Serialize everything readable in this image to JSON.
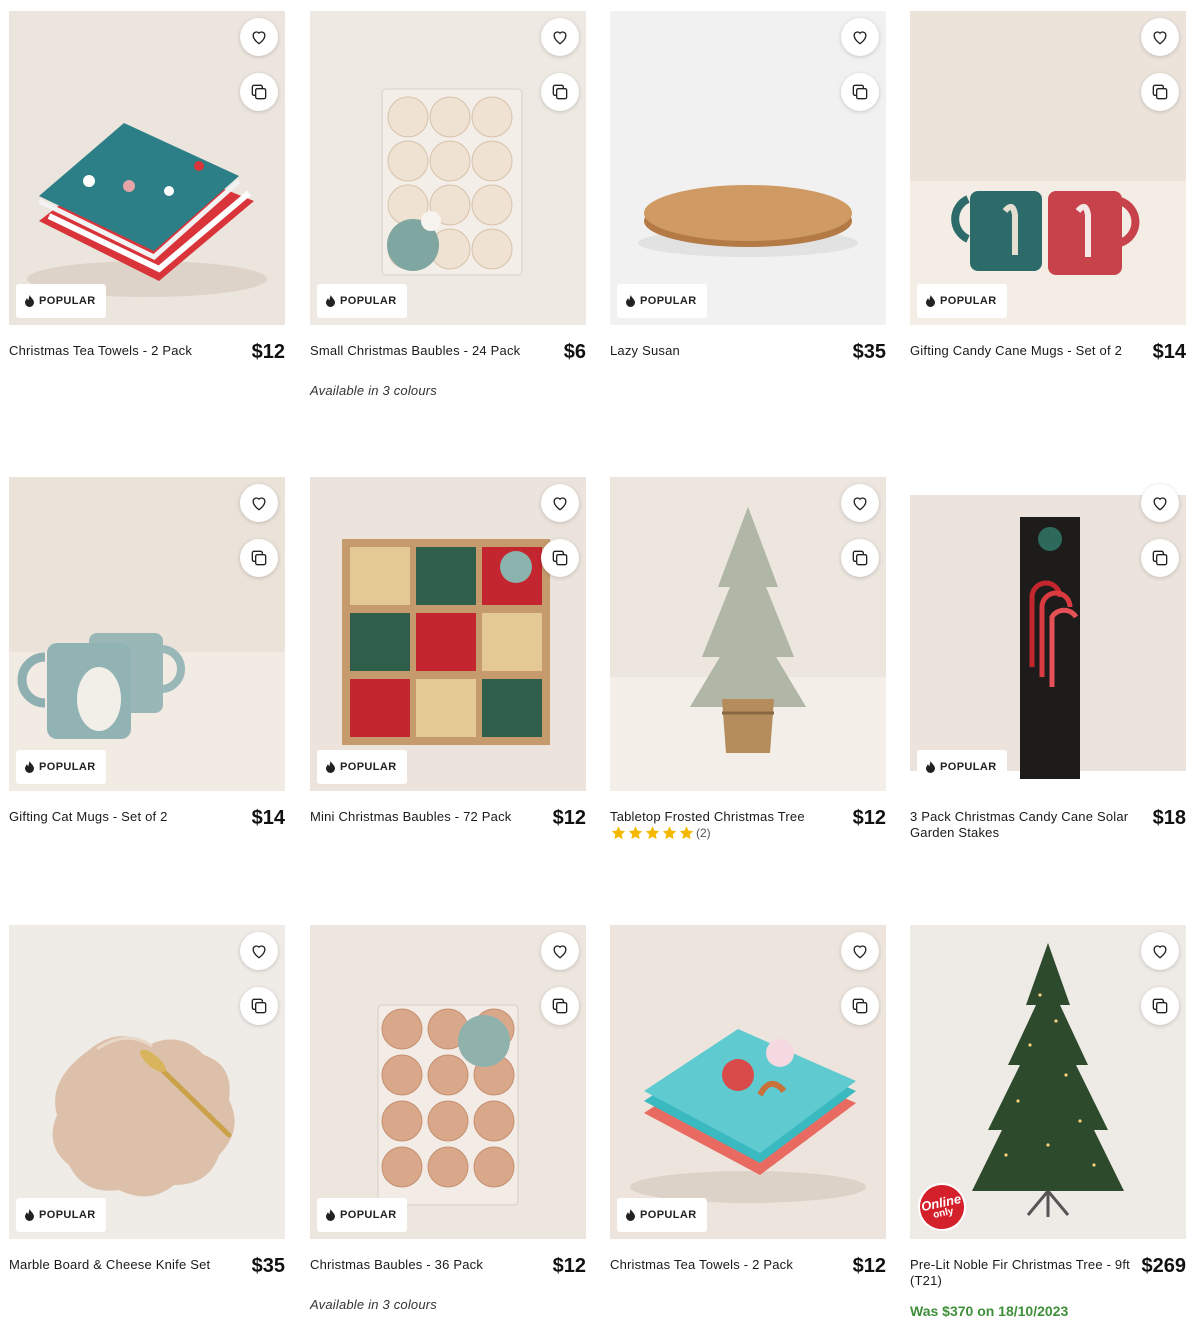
{
  "badge_label": "POPULAR",
  "online_only": {
    "line1": "Online",
    "line2": "only"
  },
  "products": [
    {
      "name": "Christmas Tea Towels - 2 Pack",
      "price": "$12",
      "badge": true,
      "icon": "tea-towels-photo"
    },
    {
      "name": "Small Christmas Baubles - 24 Pack",
      "price": "$6",
      "badge": true,
      "sub": "Available in 3 colours",
      "icon": "baubles-box-photo"
    },
    {
      "name": "Lazy Susan",
      "price": "$35",
      "badge": true,
      "icon": "lazy-susan-photo"
    },
    {
      "name": "Gifting Candy Cane Mugs - Set of 2",
      "price": "$14",
      "badge": true,
      "icon": "mugs-photo"
    },
    {
      "name": "Gifting Cat Mugs - Set of 2",
      "price": "$14",
      "badge": true,
      "icon": "cat-mugs-photo"
    },
    {
      "name": "Mini Christmas Baubles - 72 Pack",
      "price": "$12",
      "badge": true,
      "icon": "mini-baubles-photo"
    },
    {
      "name": "Tabletop Frosted Christmas Tree",
      "price": "$12",
      "badge": false,
      "rating": 5,
      "rating_count": "(2)",
      "icon": "frosted-tree-photo"
    },
    {
      "name": "3 Pack Christmas Candy Cane Solar Garden Stakes",
      "price": "$18",
      "badge": true,
      "icon": "candy-cane-stakes-photo"
    },
    {
      "name": "Marble Board & Cheese Knife Set",
      "price": "$35",
      "badge": true,
      "icon": "marble-board-photo"
    },
    {
      "name": "Christmas Baubles - 36 Pack",
      "price": "$12",
      "badge": true,
      "sub": "Available in 3 colours",
      "icon": "rose-baubles-photo"
    },
    {
      "name": "Christmas Tea Towels - 2 Pack",
      "price": "$12",
      "badge": true,
      "icon": "candy-tea-towels-photo"
    },
    {
      "name": "Pre-Lit Noble Fir Christmas Tree - 9ft (T21)",
      "price": "$269",
      "badge": false,
      "online_only": true,
      "was": "Was $370 on 18/10/2023",
      "icon": "fir-tree-photo"
    }
  ],
  "colors": {
    "was_price": "#3f8f3a",
    "star": "#f5b800",
    "online_badge": "#d4202a"
  }
}
